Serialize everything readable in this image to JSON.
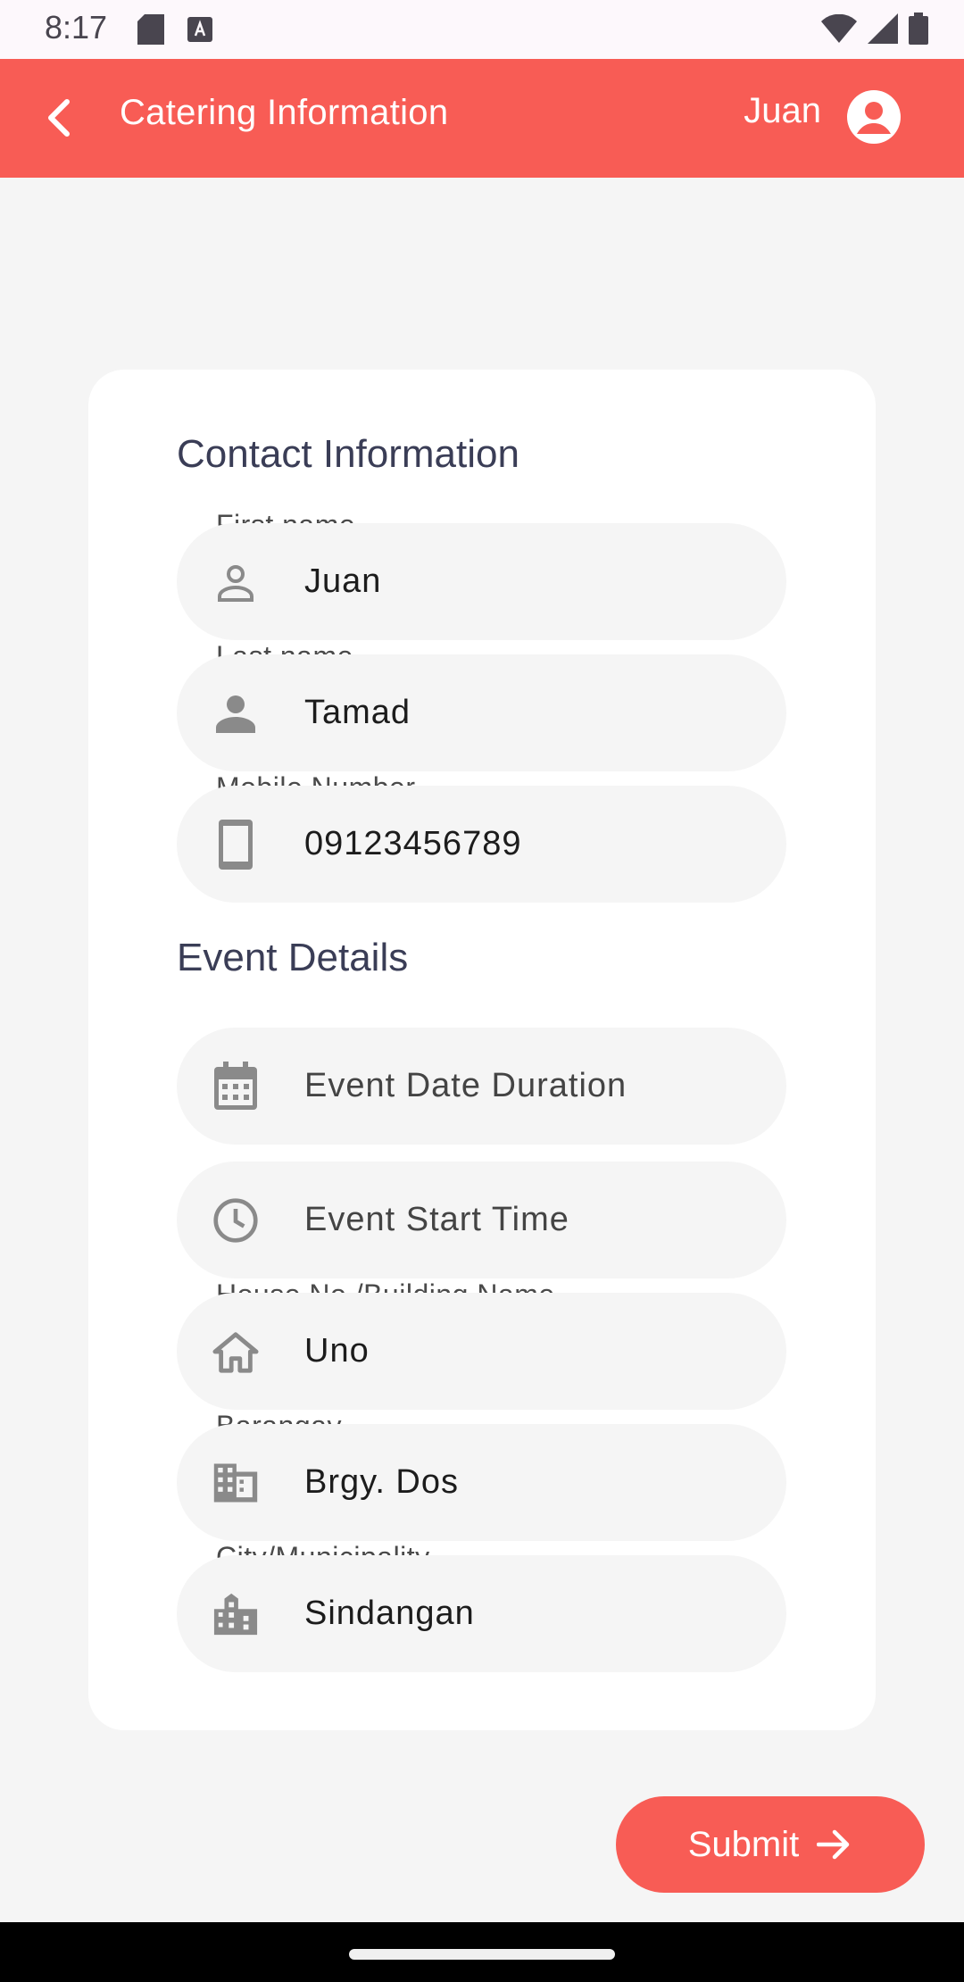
{
  "status_bar": {
    "time": "8:17",
    "icons": [
      "sd-card-icon",
      "font-a-icon",
      "wifi-icon",
      "signal-icon",
      "battery-icon"
    ]
  },
  "app_bar": {
    "title": "Catering Information",
    "user_name": "Juan",
    "icons": [
      "chevron-left-icon",
      "account-circle-icon"
    ],
    "background": "#f85c55"
  },
  "contact": {
    "title": "Contact Information",
    "first_name": {
      "label": "First name",
      "value": "Juan",
      "icon": "person-outline-icon"
    },
    "last_name": {
      "label": "Last name",
      "value": "Tamad",
      "icon": "person-icon"
    },
    "mobile": {
      "label": "Mobile Number",
      "value": "09123456789",
      "icon": "smartphone-icon"
    }
  },
  "event": {
    "title": "Event Details",
    "date": {
      "placeholder": "Event Date Duration",
      "icon": "calendar-icon"
    },
    "start_time": {
      "placeholder": "Event Start Time",
      "icon": "clock-icon"
    },
    "house": {
      "label": "House No./Building Name",
      "value": "Uno",
      "icon": "house-icon"
    },
    "barangay": {
      "label": "Barangay",
      "value": "Brgy. Dos",
      "icon": "business-icon"
    },
    "city": {
      "label": "City/Municipality",
      "value": "Sindangan",
      "icon": "city-icon"
    }
  },
  "submit": {
    "label": "Submit",
    "icon": "arrow-right-icon"
  },
  "colors": {
    "accent": "#f85c55",
    "card": "#ffffff",
    "field_bg": "#f5f5f5",
    "title": "#3a3d56"
  }
}
